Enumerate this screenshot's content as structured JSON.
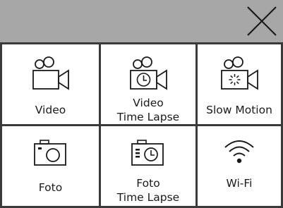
{
  "header": {
    "close_icon": "close-icon",
    "background": "#a7a7a7"
  },
  "modes": [
    {
      "id": "video",
      "icon": "video-camera-icon",
      "label_line1": "Video",
      "label_line2": ""
    },
    {
      "id": "video-time-lapse",
      "icon": "video-time-lapse-icon",
      "label_line1": "Video",
      "label_line2": "Time Lapse"
    },
    {
      "id": "slow-motion",
      "icon": "slow-motion-camera-icon",
      "label_line1": "Slow Motion",
      "label_line2": ""
    },
    {
      "id": "foto",
      "icon": "photo-camera-icon",
      "label_line1": "Foto",
      "label_line2": ""
    },
    {
      "id": "foto-time-lapse",
      "icon": "photo-time-lapse-icon",
      "label_line1": "Foto",
      "label_line2": "Time Lapse"
    },
    {
      "id": "wifi",
      "icon": "wifi-icon",
      "label_line1": "Wi-Fi",
      "label_line2": ""
    }
  ],
  "colors": {
    "border": "#3a3a3a",
    "text": "#1a1a1a",
    "icon": "#1a1a1a"
  }
}
